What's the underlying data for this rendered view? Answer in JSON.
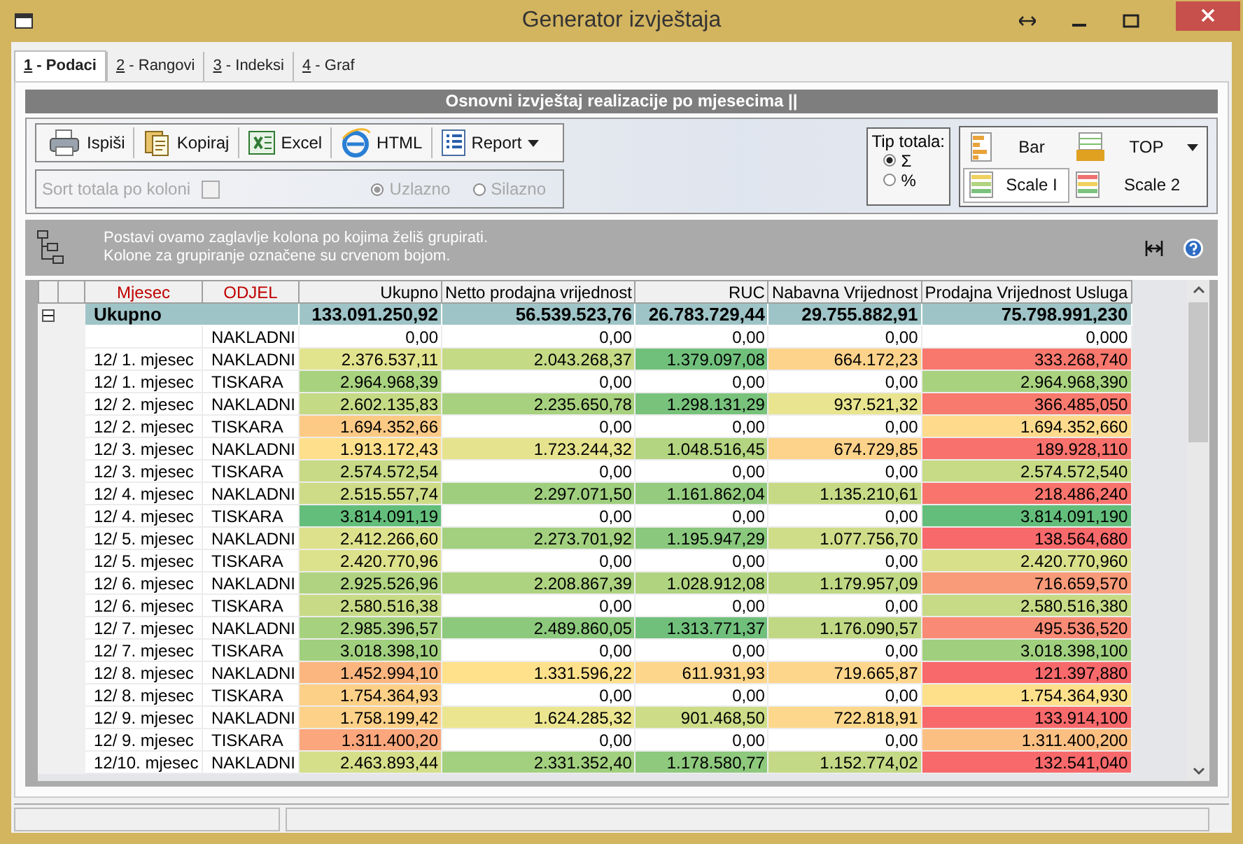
{
  "window": {
    "title": "Generator izvještaja"
  },
  "tabs": [
    {
      "hotkey": "1",
      "label": "- Podaci",
      "selected": true
    },
    {
      "hotkey": "2",
      "label": "- Rangovi",
      "selected": false
    },
    {
      "hotkey": "3",
      "label": "- Indeksi",
      "selected": false
    },
    {
      "hotkey": "4",
      "label": "- Graf",
      "selected": false
    }
  ],
  "report_title": "Osnovni izvještaj realizacije po mjesecima ||",
  "toolbar": {
    "buttons": [
      {
        "kind": "print",
        "label": "Ispiši"
      },
      {
        "kind": "copy",
        "label": "Kopiraj"
      },
      {
        "kind": "excel",
        "label": "Excel"
      },
      {
        "kind": "html",
        "label": "HTML"
      },
      {
        "kind": "report",
        "label": "Report",
        "dropdown": true
      }
    ],
    "sort": {
      "label": "Sort totala po koloni",
      "checked": false,
      "disabled": true,
      "options": [
        {
          "label": "Uzlazno",
          "selected": true
        },
        {
          "label": "Silazno",
          "selected": false
        }
      ]
    }
  },
  "tip_totala": {
    "label": "Tip totala:",
    "options": [
      {
        "label": "Σ",
        "selected": true
      },
      {
        "label": "%",
        "selected": false
      }
    ]
  },
  "view_buttons": [
    {
      "kind": "bar",
      "label": "Bar",
      "selected": false
    },
    {
      "kind": "top",
      "label": "TOP",
      "selected": false,
      "dropdown": true
    },
    {
      "kind": "scale1",
      "label": "Scale I",
      "selected": true
    },
    {
      "kind": "scale2",
      "label": "Scale 2",
      "selected": false
    }
  ],
  "group_panel": {
    "hint_lines": [
      "Postavi ovamo zaglavlje kolona po kojima želiš grupirati.",
      "Kolone za grupiranje označene su crvenom bojom."
    ]
  },
  "table": {
    "columns": [
      {
        "label": "Mjesec",
        "grouped": true
      },
      {
        "label": "ODJEL",
        "grouped": true
      },
      {
        "label": "Ukupno",
        "grouped": false
      },
      {
        "label": "Netto prodajna vrijednost",
        "grouped": false
      },
      {
        "label": "RUC",
        "grouped": false
      },
      {
        "label": "Nabavna Vrijednost",
        "grouped": false
      },
      {
        "label": "Prodajna Vrijednost Usluga",
        "grouped": false
      }
    ],
    "total_row": {
      "label": "Ukupno",
      "expanded": true,
      "values": [
        "133.091.250,92",
        "56.539.523,76",
        "26.783.729,44",
        "29.755.882,91",
        "75.798.991,230"
      ]
    },
    "rows": [
      {
        "cells": [
          {
            "text": ""
          },
          {
            "text": "NAKLADNI"
          },
          {
            "text": "0,00",
            "color": "#ffffff"
          },
          {
            "text": "0,00",
            "color": "#ffffff"
          },
          {
            "text": "0,00",
            "color": "#ffffff"
          },
          {
            "text": "0,00",
            "color": "#ffffff"
          },
          {
            "text": "0,000",
            "color": "#ffffff"
          }
        ]
      },
      {
        "cells": [
          {
            "text": "12/ 1. mjesec"
          },
          {
            "text": "NAKLADNI"
          },
          {
            "text": "2.376.537,11",
            "color": "#e2e38d"
          },
          {
            "text": "2.043.268,37",
            "color": "#c4da85"
          },
          {
            "text": "1.379.097,08",
            "color": "#70c07c"
          },
          {
            "text": "664.172,23",
            "color": "#fdd28a"
          },
          {
            "text": "333.268,740",
            "color": "#f8786e"
          }
        ]
      },
      {
        "cells": [
          {
            "text": "12/ 1. mjesec"
          },
          {
            "text": "TISKARA"
          },
          {
            "text": "2.964.968,39",
            "color": "#a9d27f"
          },
          {
            "text": "0,00",
            "color": "#ffffff"
          },
          {
            "text": "0,00",
            "color": "#ffffff"
          },
          {
            "text": "0,00",
            "color": "#ffffff"
          },
          {
            "text": "2.964.968,390",
            "color": "#a9d27f"
          }
        ]
      },
      {
        "cells": [
          {
            "text": "12/ 2. mjesec"
          },
          {
            "text": "NAKLADNI"
          },
          {
            "text": "2.602.135,83",
            "color": "#c5da85"
          },
          {
            "text": "2.235.650,78",
            "color": "#a8d17f"
          },
          {
            "text": "1.298.131,29",
            "color": "#78c27c"
          },
          {
            "text": "937.521,32",
            "color": "#e8e48f"
          },
          {
            "text": "366.485,050",
            "color": "#f8796e"
          }
        ]
      },
      {
        "cells": [
          {
            "text": "12/ 2. mjesec"
          },
          {
            "text": "TISKARA"
          },
          {
            "text": "1.694.352,66",
            "color": "#fdca85"
          },
          {
            "text": "0,00",
            "color": "#ffffff"
          },
          {
            "text": "0,00",
            "color": "#ffffff"
          },
          {
            "text": "0,00",
            "color": "#ffffff"
          },
          {
            "text": "1.694.352,660",
            "color": "#fedb8c"
          }
        ]
      },
      {
        "cells": [
          {
            "text": "12/ 3. mjesec"
          },
          {
            "text": "NAKLADNI"
          },
          {
            "text": "1.913.172,43",
            "color": "#fedf8c"
          },
          {
            "text": "1.723.244,32",
            "color": "#e6e38e"
          },
          {
            "text": "1.048.516,45",
            "color": "#b3d480"
          },
          {
            "text": "674.729,85",
            "color": "#fdd28a"
          },
          {
            "text": "189.928,110",
            "color": "#f8716c"
          }
        ]
      },
      {
        "cells": [
          {
            "text": "12/ 3. mjesec"
          },
          {
            "text": "TISKARA"
          },
          {
            "text": "2.574.572,54",
            "color": "#c8da86"
          },
          {
            "text": "0,00",
            "color": "#ffffff"
          },
          {
            "text": "0,00",
            "color": "#ffffff"
          },
          {
            "text": "0,00",
            "color": "#ffffff"
          },
          {
            "text": "2.574.572,540",
            "color": "#c7da86"
          }
        ]
      },
      {
        "cells": [
          {
            "text": "12/ 4. mjesec"
          },
          {
            "text": "NAKLADNI"
          },
          {
            "text": "2.515.557,74",
            "color": "#cedc87"
          },
          {
            "text": "2.297.071,50",
            "color": "#9fcf7e"
          },
          {
            "text": "1.161.862,04",
            "color": "#94cb7e"
          },
          {
            "text": "1.135.210,61",
            "color": "#c6da85"
          },
          {
            "text": "218.486,240",
            "color": "#f8746d"
          }
        ]
      },
      {
        "cells": [
          {
            "text": "12/ 4. mjesec"
          },
          {
            "text": "TISKARA"
          },
          {
            "text": "3.814.091,19",
            "color": "#63be7b"
          },
          {
            "text": "0,00",
            "color": "#ffffff"
          },
          {
            "text": "0,00",
            "color": "#ffffff"
          },
          {
            "text": "0,00",
            "color": "#ffffff"
          },
          {
            "text": "3.814.091,190",
            "color": "#63be7b"
          }
        ]
      },
      {
        "cells": [
          {
            "text": "12/ 5. mjesec"
          },
          {
            "text": "NAKLADNI"
          },
          {
            "text": "2.412.266,60",
            "color": "#dde18c"
          },
          {
            "text": "2.273.701,92",
            "color": "#a2d07f"
          },
          {
            "text": "1.195.947,29",
            "color": "#8ac97d"
          },
          {
            "text": "1.077.756,70",
            "color": "#cfdd88"
          },
          {
            "text": "138.564,680",
            "color": "#f8696b"
          }
        ]
      },
      {
        "cells": [
          {
            "text": "12/ 5. mjesec"
          },
          {
            "text": "TISKARA"
          },
          {
            "text": "2.420.770,96",
            "color": "#dce18b"
          },
          {
            "text": "0,00",
            "color": "#ffffff"
          },
          {
            "text": "0,00",
            "color": "#ffffff"
          },
          {
            "text": "0,00",
            "color": "#ffffff"
          },
          {
            "text": "2.420.770,960",
            "color": "#d8e08a"
          }
        ]
      },
      {
        "cells": [
          {
            "text": "12/ 6. mjesec"
          },
          {
            "text": "NAKLADNI"
          },
          {
            "text": "2.925.526,96",
            "color": "#afd380"
          },
          {
            "text": "2.208.867,39",
            "color": "#add280"
          },
          {
            "text": "1.028.912,08",
            "color": "#b0d380"
          },
          {
            "text": "1.179.957,09",
            "color": "#bfd884"
          },
          {
            "text": "716.659,570",
            "color": "#f99a79"
          }
        ]
      },
      {
        "cells": [
          {
            "text": "12/ 6. mjesec"
          },
          {
            "text": "TISKARA"
          },
          {
            "text": "2.580.516,38",
            "color": "#c8da86"
          },
          {
            "text": "0,00",
            "color": "#ffffff"
          },
          {
            "text": "0,00",
            "color": "#ffffff"
          },
          {
            "text": "0,00",
            "color": "#ffffff"
          },
          {
            "text": "2.580.516,380",
            "color": "#c7da86"
          }
        ]
      },
      {
        "cells": [
          {
            "text": "12/ 7. mjesec"
          },
          {
            "text": "NAKLADNI"
          },
          {
            "text": "2.985.396,57",
            "color": "#a6d17f"
          },
          {
            "text": "2.489.860,05",
            "color": "#8cc97d"
          },
          {
            "text": "1.313.771,37",
            "color": "#70c07c"
          },
          {
            "text": "1.176.090,57",
            "color": "#c0d884"
          },
          {
            "text": "495.536,520",
            "color": "#f98a75"
          }
        ]
      },
      {
        "cells": [
          {
            "text": "12/ 7. mjesec"
          },
          {
            "text": "TISKARA"
          },
          {
            "text": "3.018.398,10",
            "color": "#a0cf7e"
          },
          {
            "text": "0,00",
            "color": "#ffffff"
          },
          {
            "text": "0,00",
            "color": "#ffffff"
          },
          {
            "text": "0,00",
            "color": "#ffffff"
          },
          {
            "text": "3.018.398,100",
            "color": "#a0cf7e"
          }
        ]
      },
      {
        "cells": [
          {
            "text": "12/ 8. mjesec"
          },
          {
            "text": "NAKLADNI"
          },
          {
            "text": "1.452.994,10",
            "color": "#fbb67f"
          },
          {
            "text": "1.331.596,22",
            "color": "#ffe08b"
          },
          {
            "text": "611.931,93",
            "color": "#fdd68b"
          },
          {
            "text": "719.665,87",
            "color": "#fdd68b"
          },
          {
            "text": "121.397,880",
            "color": "#f8696b"
          }
        ]
      },
      {
        "cells": [
          {
            "text": "12/ 8. mjesec"
          },
          {
            "text": "TISKARA"
          },
          {
            "text": "1.754.364,93",
            "color": "#fdd087"
          },
          {
            "text": "0,00",
            "color": "#ffffff"
          },
          {
            "text": "0,00",
            "color": "#ffffff"
          },
          {
            "text": "0,00",
            "color": "#ffffff"
          },
          {
            "text": "1.754.364,930",
            "color": "#fee08b"
          }
        ]
      },
      {
        "cells": [
          {
            "text": "12/ 9. mjesec"
          },
          {
            "text": "NAKLADNI"
          },
          {
            "text": "1.758.199,42",
            "color": "#fdd188"
          },
          {
            "text": "1.624.285,32",
            "color": "#ebe590"
          },
          {
            "text": "901.468,50",
            "color": "#ccdc87"
          },
          {
            "text": "722.818,91",
            "color": "#fdd78b"
          },
          {
            "text": "133.914,100",
            "color": "#f8696b"
          }
        ]
      },
      {
        "cells": [
          {
            "text": "12/ 9. mjesec"
          },
          {
            "text": "TISKARA"
          },
          {
            "text": "1.311.400,20",
            "color": "#fba67c"
          },
          {
            "text": "0,00",
            "color": "#ffffff"
          },
          {
            "text": "0,00",
            "color": "#ffffff"
          },
          {
            "text": "0,00",
            "color": "#ffffff"
          },
          {
            "text": "1.311.400,200",
            "color": "#fcbf82"
          }
        ]
      },
      {
        "cells": [
          {
            "text": "12/10. mjesec"
          },
          {
            "text": "NAKLADNI"
          },
          {
            "text": "2.463.893,44",
            "color": "#d5df89"
          },
          {
            "text": "2.331.352,40",
            "color": "#a2d07f"
          },
          {
            "text": "1.178.580,77",
            "color": "#8ec97d"
          },
          {
            "text": "1.152.774,02",
            "color": "#c4d985"
          },
          {
            "text": "132.541,040",
            "color": "#f8696b"
          }
        ]
      }
    ]
  }
}
